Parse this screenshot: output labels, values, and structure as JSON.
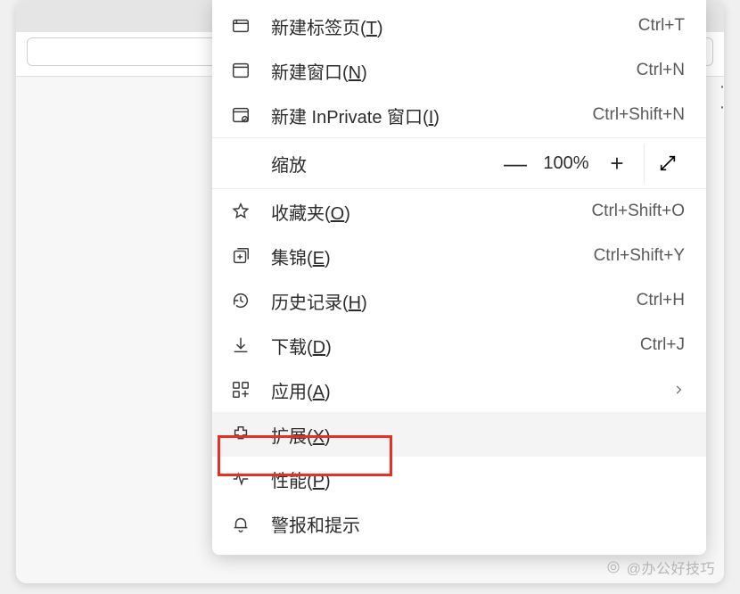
{
  "menu": {
    "items": [
      {
        "label": "新建标签页(T)",
        "underline": "T",
        "shortcut": "Ctrl+T",
        "icon": "new-tab"
      },
      {
        "label": "新建窗口(N)",
        "underline": "N",
        "shortcut": "Ctrl+N",
        "icon": "new-window"
      },
      {
        "label": "新建 InPrivate 窗口(I)",
        "underline": "I",
        "shortcut": "Ctrl+Shift+N",
        "icon": "inprivate"
      }
    ],
    "zoom": {
      "label": "缩放",
      "percent": "100%",
      "minus": "—",
      "plus": "+"
    },
    "items2": [
      {
        "label": "收藏夹(O)",
        "underline": "O",
        "shortcut": "Ctrl+Shift+O",
        "icon": "favorites"
      },
      {
        "label": "集锦(E)",
        "underline": "E",
        "shortcut": "Ctrl+Shift+Y",
        "icon": "collections"
      },
      {
        "label": "历史记录(H)",
        "underline": "H",
        "shortcut": "Ctrl+H",
        "icon": "history"
      },
      {
        "label": "下载(D)",
        "underline": "D",
        "shortcut": "Ctrl+J",
        "icon": "downloads"
      },
      {
        "label": "应用(A)",
        "underline": "A",
        "shortcut": "",
        "icon": "apps",
        "submenu": true
      },
      {
        "label": "扩展(X)",
        "underline": "X",
        "shortcut": "",
        "icon": "extensions",
        "highlighted": true
      },
      {
        "label": "性能(P)",
        "underline": "P",
        "shortcut": "",
        "icon": "performance"
      },
      {
        "label": "警报和提示",
        "underline": "",
        "shortcut": "",
        "icon": "alerts"
      }
    ]
  },
  "watermark": "@办公好技巧"
}
